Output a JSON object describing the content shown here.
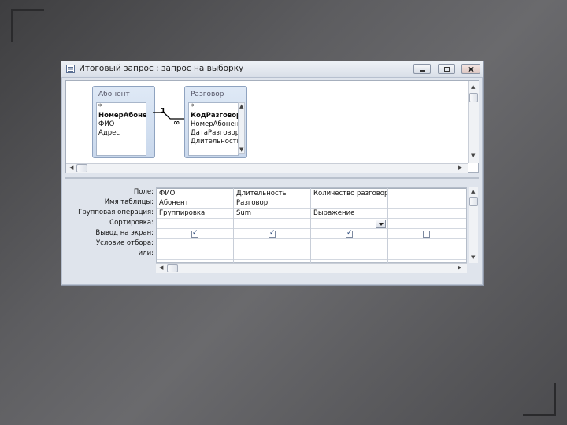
{
  "window": {
    "title": "Итоговый запрос : запрос на выборку"
  },
  "tables": [
    {
      "name": "Абонент",
      "fields": [
        {
          "label": "*",
          "key": false
        },
        {
          "label": "НомерАбонента",
          "key": true
        },
        {
          "label": "ФИО",
          "key": false
        },
        {
          "label": "Адрес",
          "key": false
        }
      ]
    },
    {
      "name": "Разговор",
      "fields": [
        {
          "label": "*",
          "key": false
        },
        {
          "label": "КодРазговора",
          "key": true
        },
        {
          "label": "НомерАбонента",
          "key": false
        },
        {
          "label": "ДатаРазговора",
          "key": false
        },
        {
          "label": "Длительность",
          "key": false
        }
      ]
    }
  ],
  "relation": {
    "one_label": "1",
    "many_label": "∞"
  },
  "grid": {
    "row_labels": [
      "Поле:",
      "Имя таблицы:",
      "Групповая операция:",
      "Сортировка:",
      "Вывод на экран:",
      "Условие отбора:",
      "или:"
    ],
    "columns": [
      {
        "field": "ФИО",
        "table": "Абонент",
        "group": "Группировка",
        "sort": "",
        "show": true,
        "criteria": "",
        "or": ""
      },
      {
        "field": "Длительность",
        "table": "Разговор",
        "group": "Sum",
        "sort": "",
        "show": true,
        "criteria": "",
        "or": ""
      },
      {
        "field": "Количество разговоров",
        "table": "",
        "group": "Выражение",
        "sort": "",
        "show": true,
        "criteria": "",
        "or": "",
        "has_dropdown": true
      },
      {
        "field": "",
        "table": "",
        "group": "",
        "sort": "",
        "show": false,
        "criteria": "",
        "or": ""
      }
    ]
  },
  "icons": {
    "app": "query-icon",
    "minimize": "minimize-icon",
    "maximize": "maximize-icon",
    "close": "close-icon",
    "check": "checkmark-icon",
    "dropdown": "chevron-down-icon"
  },
  "colors": {
    "window_bg": "#dfe4ec",
    "table_header": "#c9d8ec",
    "slide_bg": "#5d5d60"
  }
}
